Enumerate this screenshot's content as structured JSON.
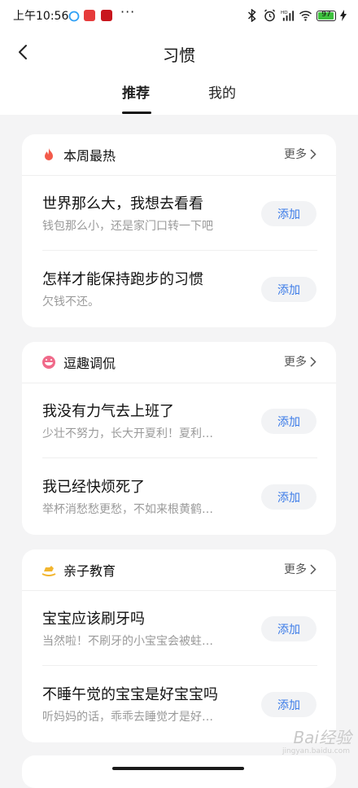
{
  "status_bar": {
    "time": "上午10:56",
    "more": "···",
    "signal_type": "HD",
    "battery_level": 97,
    "colors": {
      "battery_fill": "#3ec13e",
      "notif_1": "#2fa0f5",
      "notif_2": "#e63b3b",
      "notif_3": "#c8161d"
    }
  },
  "header": {
    "title": "习惯",
    "back_icon": "chevron-left-icon"
  },
  "tabs": [
    {
      "label": "推荐",
      "active": true
    },
    {
      "label": "我的",
      "active": false
    }
  ],
  "sections": [
    {
      "title": "本周最热",
      "icon": "flame-icon",
      "more_label": "更多",
      "items": [
        {
          "title": "世界那么大，我想去看看",
          "subtitle": "钱包那么小，还是家门口转一下吧",
          "button": "添加"
        },
        {
          "title": "怎样才能保持跑步的习惯",
          "subtitle": "欠钱不还。",
          "button": "添加"
        }
      ]
    },
    {
      "title": "逗趣调侃",
      "icon": "grin-face-icon",
      "more_label": "更多",
      "items": [
        {
          "title": "我没有力气去上班了",
          "subtitle": "少壮不努力，长大开夏利！夏利…",
          "button": "添加"
        },
        {
          "title": "我已经快烦死了",
          "subtitle": "举杯消愁愁更愁，不如来根黄鹤…",
          "button": "添加"
        }
      ]
    },
    {
      "title": "亲子教育",
      "icon": "rocking-horse-icon",
      "more_label": "更多",
      "items": [
        {
          "title": "宝宝应该刷牙吗",
          "subtitle": "当然啦！不刷牙的小宝宝会被蛀…",
          "button": "添加"
        },
        {
          "title": "不睡午觉的宝宝是好宝宝吗",
          "subtitle": "听妈妈的话，乖乖去睡觉才是好…",
          "button": "添加"
        }
      ]
    }
  ],
  "watermark": {
    "text": "Bai经验",
    "sub": "jingyan.baidu.com"
  },
  "colors": {
    "accent": "#3b7be8",
    "page_bg": "#f4f4f5",
    "card_bg": "#ffffff",
    "secondary_text": "#9a9a9a"
  }
}
